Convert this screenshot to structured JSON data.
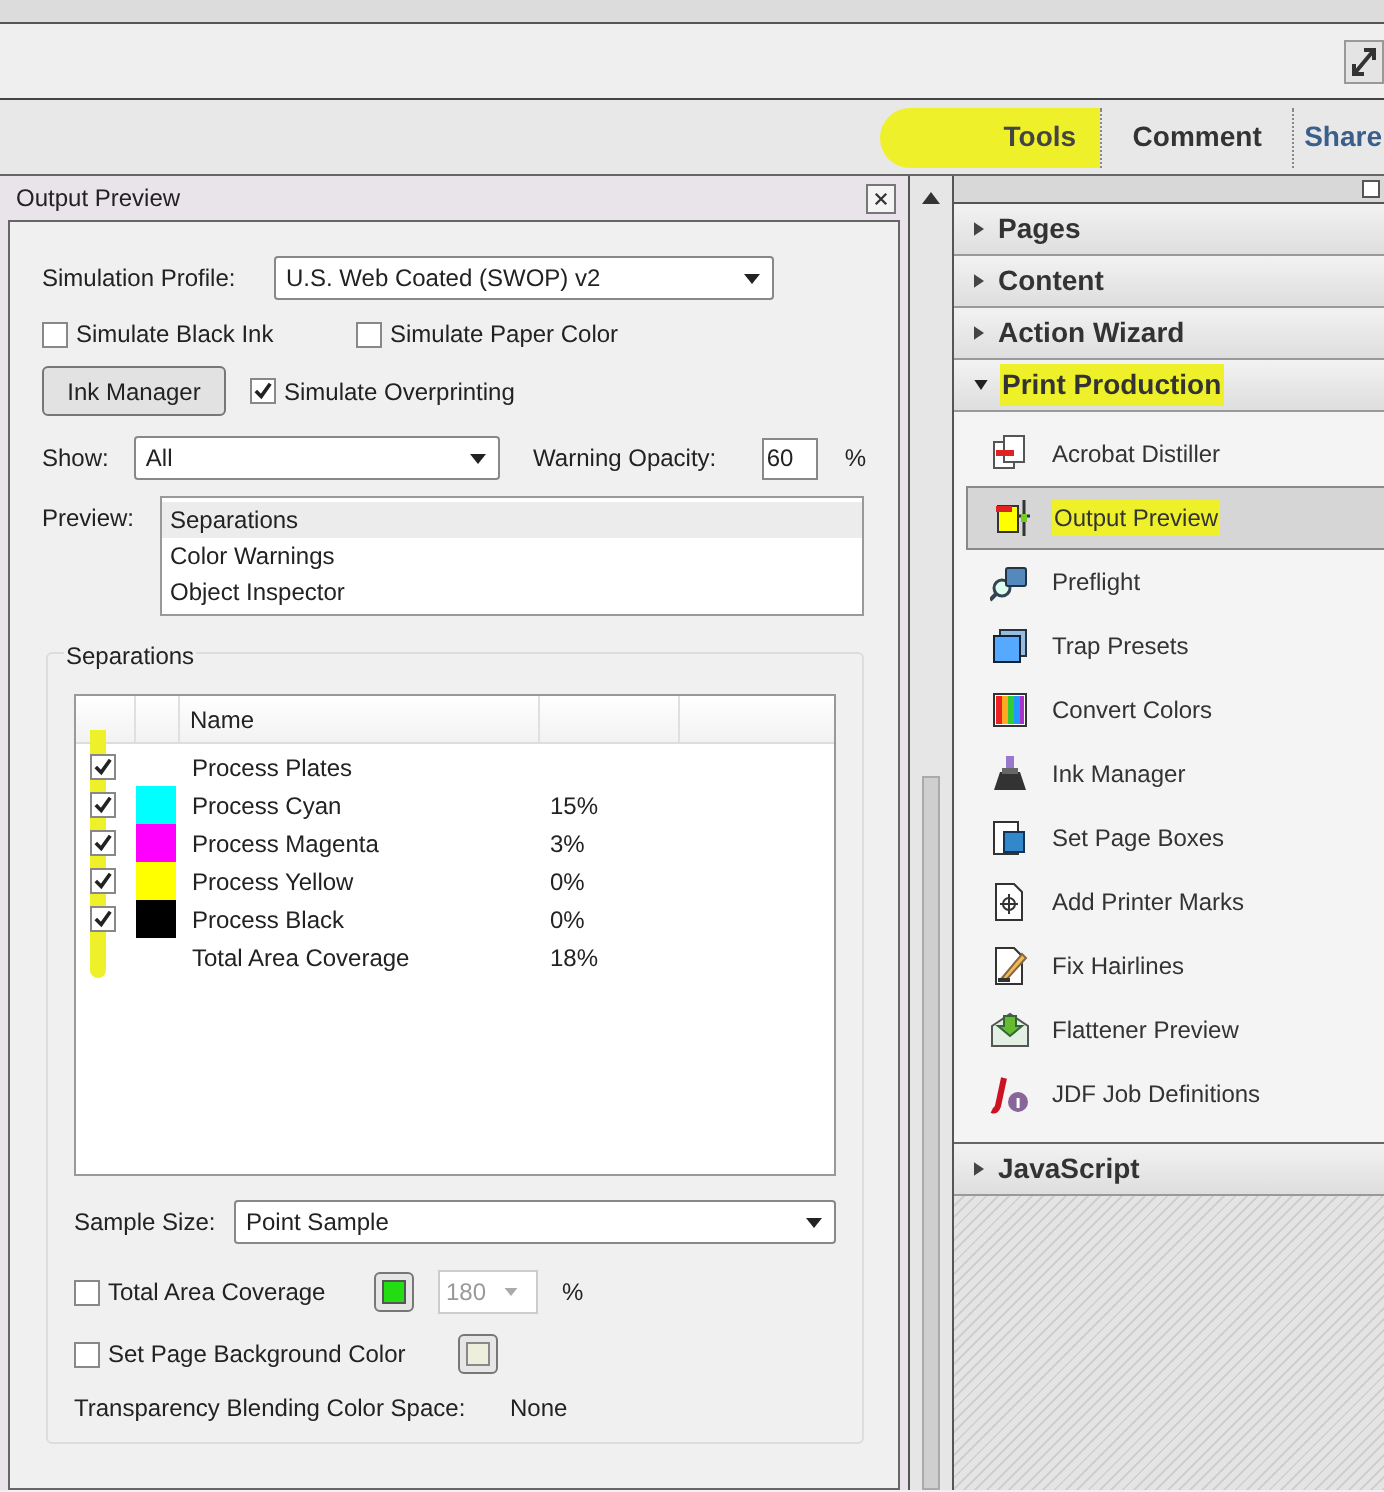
{
  "tabs": [
    {
      "label": "Tools",
      "selected": false,
      "highlighted": true
    },
    {
      "label": "Comment",
      "selected": false,
      "highlighted": false
    },
    {
      "label": "Share",
      "selected": false,
      "highlighted": false
    }
  ],
  "dialog": {
    "title": "Output Preview",
    "simulation_profile": {
      "label": "Simulation Profile:",
      "value": "U.S. Web Coated (SWOP) v2"
    },
    "options": [
      {
        "label": "Simulate Black Ink",
        "checked": false
      },
      {
        "label": "Simulate Paper Color",
        "checked": false
      }
    ],
    "ink_manager_button": "Ink Manager",
    "simulate_overprinting": {
      "label": "Simulate Overprinting",
      "checked": true
    },
    "show": {
      "label": "Show:",
      "value": "All"
    },
    "warning_opacity": {
      "label": "Warning Opacity:",
      "value": "60",
      "unit": "%"
    },
    "preview": {
      "label": "Preview:",
      "items": [
        {
          "label": "Separations",
          "selected": true
        },
        {
          "label": "Color Warnings",
          "selected": false
        },
        {
          "label": "Object Inspector",
          "selected": false
        }
      ]
    },
    "separations": {
      "title": "Separations",
      "column_name": "Name",
      "highlighted": true,
      "rows": [
        {
          "kind": "plates",
          "name": "Process Plates",
          "checked": true
        },
        {
          "kind": "ink",
          "name": "Process Cyan",
          "checked": true,
          "color": "#00ffff",
          "coverage": "15%"
        },
        {
          "kind": "ink",
          "name": "Process Magenta",
          "checked": true,
          "color": "#ff00ff",
          "coverage": "3%"
        },
        {
          "kind": "ink",
          "name": "Process Yellow",
          "checked": true,
          "color": "#ffff00",
          "coverage": "0%"
        },
        {
          "kind": "ink",
          "name": "Process Black",
          "checked": true,
          "color": "#000000",
          "coverage": "0%"
        },
        {
          "kind": "total",
          "name": "Total Area Coverage",
          "coverage": "18%"
        }
      ]
    },
    "sample_size": {
      "label": "Sample Size:",
      "value": "Point Sample"
    },
    "total_area_coverage": {
      "label": "Total Area Coverage",
      "checked": false,
      "color": "#22dd11",
      "value": "180",
      "unit": "%"
    },
    "page_background": {
      "label": "Set Page Background Color",
      "checked": false,
      "color": "#eeeedd"
    },
    "blending": {
      "label": "Transparency Blending Color Space:",
      "value": "None"
    }
  },
  "panel": {
    "sections_before": [
      {
        "label": "Pages",
        "expanded": false,
        "highlighted": false
      },
      {
        "label": "Content",
        "expanded": false,
        "highlighted": false
      },
      {
        "label": "Action Wizard",
        "expanded": false,
        "highlighted": false
      },
      {
        "label": "Print Production",
        "expanded": true,
        "highlighted": true
      }
    ],
    "tools": [
      {
        "label": "Acrobat Distiller",
        "selected": false,
        "highlighted": false
      },
      {
        "label": "Output Preview",
        "selected": true,
        "highlighted": true
      },
      {
        "label": "Preflight",
        "selected": false,
        "highlighted": false
      },
      {
        "label": "Trap Presets",
        "selected": false,
        "highlighted": false
      },
      {
        "label": "Convert Colors",
        "selected": false,
        "highlighted": false
      },
      {
        "label": "Ink Manager",
        "selected": false,
        "highlighted": false
      },
      {
        "label": "Set Page Boxes",
        "selected": false,
        "highlighted": false
      },
      {
        "label": "Add Printer Marks",
        "selected": false,
        "highlighted": false
      },
      {
        "label": "Fix Hairlines",
        "selected": false,
        "highlighted": false
      },
      {
        "label": "Flattener Preview",
        "selected": false,
        "highlighted": false
      },
      {
        "label": "JDF Job Definitions",
        "selected": false,
        "highlighted": false
      }
    ],
    "sections_after": [
      {
        "label": "JavaScript",
        "expanded": false,
        "highlighted": false
      }
    ]
  }
}
